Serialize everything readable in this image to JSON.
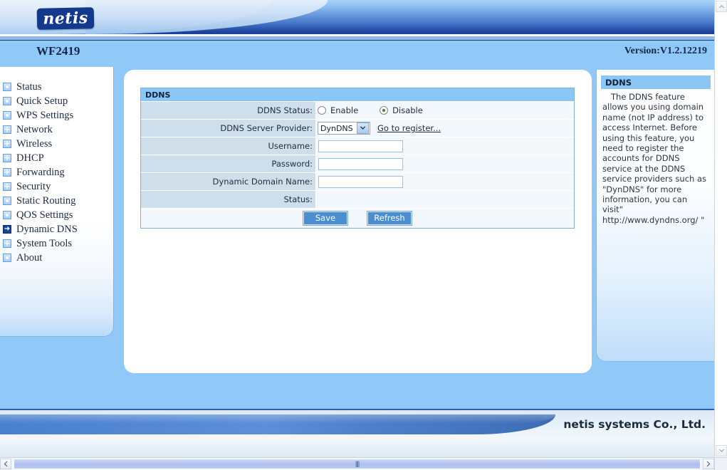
{
  "header": {
    "brand": "netis",
    "model": "WF2419",
    "version": "Version:V1.2.12219"
  },
  "sidebar": {
    "items": [
      {
        "label": "Status",
        "icon": "square-dot-icon",
        "state": "leaf"
      },
      {
        "label": "Quick Setup",
        "icon": "square-dot-icon",
        "state": "leaf"
      },
      {
        "label": "WPS Settings",
        "icon": "square-dot-icon",
        "state": "leaf"
      },
      {
        "label": "Network",
        "icon": "plus-expand-icon",
        "state": "expandable"
      },
      {
        "label": "Wireless",
        "icon": "plus-expand-icon",
        "state": "expandable"
      },
      {
        "label": "DHCP",
        "icon": "plus-expand-icon",
        "state": "expandable"
      },
      {
        "label": "Forwarding",
        "icon": "plus-expand-icon",
        "state": "expandable"
      },
      {
        "label": "Security",
        "icon": "plus-expand-icon",
        "state": "expandable"
      },
      {
        "label": "Static Routing",
        "icon": "square-dot-icon",
        "state": "leaf"
      },
      {
        "label": "QOS Settings",
        "icon": "square-dot-icon",
        "state": "leaf"
      },
      {
        "label": "Dynamic DNS",
        "icon": "arrow-right-icon",
        "state": "active"
      },
      {
        "label": "System Tools",
        "icon": "plus-expand-icon",
        "state": "expandable"
      },
      {
        "label": "About",
        "icon": "square-dot-icon",
        "state": "leaf"
      }
    ]
  },
  "main": {
    "box_title": "DDNS",
    "rows": {
      "ddns_status": {
        "label": "DDNS Status:",
        "options": [
          {
            "label": "Enable",
            "selected": false
          },
          {
            "label": "Disable",
            "selected": true
          }
        ]
      },
      "provider": {
        "label": "DDNS Server Provider:",
        "selected": "DynDNS",
        "options": [
          "DynDNS"
        ],
        "link": "Go to register..."
      },
      "username": {
        "label": "Username:",
        "value": "",
        "placeholder": ""
      },
      "password": {
        "label": "Password:",
        "value": "",
        "placeholder": ""
      },
      "domain": {
        "label": "Dynamic Domain Name:",
        "value": "",
        "placeholder": ""
      },
      "status": {
        "label": "Status:",
        "value": ""
      }
    },
    "buttons": {
      "save": "Save",
      "refresh": "Refresh"
    }
  },
  "help": {
    "title": "DDNS",
    "body": "The DDNS feature allows you using domain name (not IP address) to access Internet. Before using this feature, you need to register the accounts for DDNS service at the DDNS service providers such as \"DynDNS\" for more information, you can visit\" http://www.dyndns.org/ \""
  },
  "footer": {
    "company": "netis systems Co., Ltd."
  },
  "colors": {
    "brand_navy": "#13398c",
    "header_blue": "#90c8f8",
    "panel_title": "#8cc6f4",
    "label_cell": "#cfdeeb",
    "button_blue": "#4a8dd0",
    "radio_selected": "#2f8b2f"
  },
  "scrollbars": {
    "vertical_up": "▲",
    "vertical_down": "▼",
    "horizontal_left": "‹",
    "horizontal_right": "›",
    "thumb_grip": "||||"
  }
}
